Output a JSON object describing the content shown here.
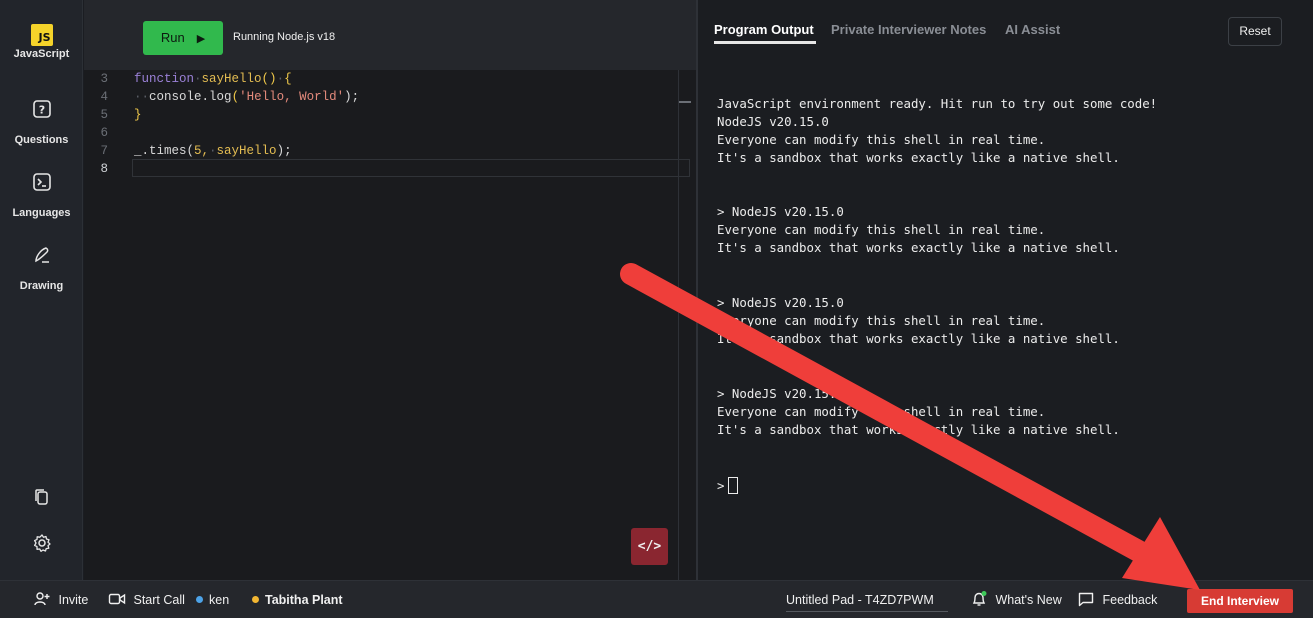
{
  "sidebar": {
    "logo_text": "JS",
    "items": [
      {
        "label": "JavaScript",
        "icon": "javascript-logo"
      },
      {
        "label": "Questions",
        "icon": "question-icon"
      },
      {
        "label": "Languages",
        "icon": "terminal-icon"
      },
      {
        "label": "Drawing",
        "icon": "pen-icon"
      }
    ],
    "bottom_icons": [
      "copy-icon",
      "gear-icon"
    ]
  },
  "editor": {
    "run_label": "Run",
    "runtime_label": "Running Node.js v18",
    "line_numbers": [
      "3",
      "4",
      "5",
      "6",
      "7",
      "8"
    ],
    "code": {
      "l3_kw": "function",
      "l3_fn": "sayHello",
      "l3_paren": "()",
      "l3_brace": "{",
      "l4_obj": "console",
      "l4_method": "log",
      "l4_str": "'Hello, World'",
      "l4_end": ");",
      "l5_brace": "}",
      "l7_prefix": "_.times(",
      "l7_num": "5,",
      "l7_arg": "sayHello",
      "l7_end": ");"
    },
    "toggle_glyph": "</>"
  },
  "output": {
    "tabs": [
      "Program Output",
      "Private Interviewer Notes",
      "AI Assist"
    ],
    "active_tab": "Program Output",
    "reset_label": "Reset",
    "console_lines": [
      "JavaScript environment ready. Hit run to try out some code!",
      "NodeJS v20.15.0",
      "Everyone can modify this shell in real time.",
      "It's a sandbox that works exactly like a native shell.",
      "> NodeJS v20.15.0",
      "Everyone can modify this shell in real time.",
      "It's a sandbox that works exactly like a native shell.",
      "> NodeJS v20.15.0",
      "Everyone can modify this shell in real time.",
      "It's a sandbox that works exactly like a native shell.",
      "> NodeJS v20.15.0",
      "Everyone can modify this shell in real time.",
      "It's a sandbox that works exactly like a native shell.",
      ">"
    ]
  },
  "bottombar": {
    "invite_label": "Invite",
    "start_call_label": "Start Call",
    "users": [
      {
        "name": "ken",
        "color": "#4da3e8"
      },
      {
        "name": "Tabitha Plant",
        "color": "#f2b632"
      }
    ],
    "pad_title": "Untitled Pad - T4ZD7PWM",
    "whats_new_label": "What's New",
    "feedback_label": "Feedback",
    "end_interview_label": "End Interview"
  },
  "colors": {
    "run_green": "#31b94d",
    "end_red": "#d73b34",
    "annotation_arrow": "#ef3e3a",
    "js_yellow": "#f5d32a"
  }
}
